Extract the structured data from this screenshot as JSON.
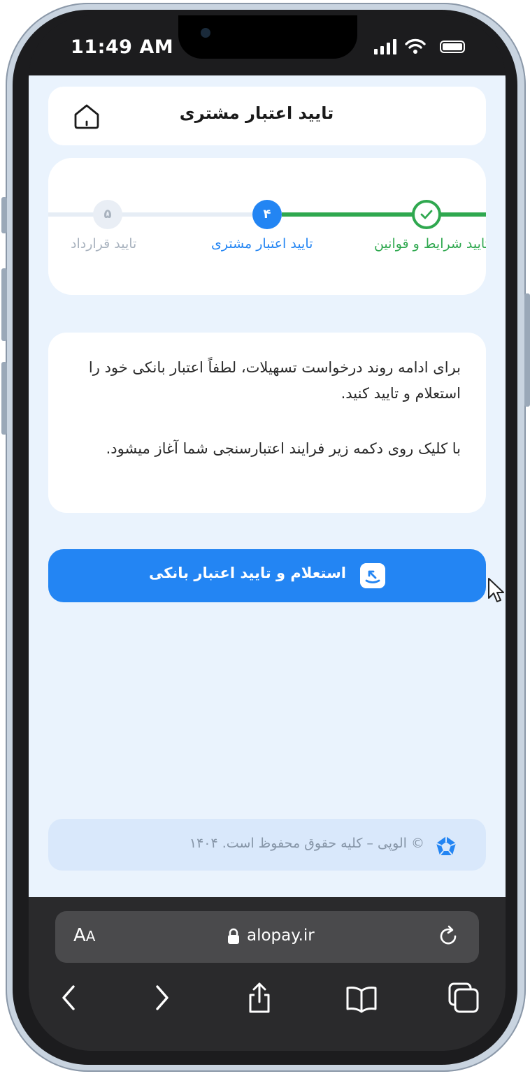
{
  "status_bar": {
    "time": "11:49 AM"
  },
  "header": {
    "title": "تایید اعتبار مشتری"
  },
  "stepper": {
    "steps": [
      {
        "label": "تایید شرایط و قوانین",
        "state": "completed"
      },
      {
        "number": "۴",
        "label": "تایید اعتبار مشتری",
        "state": "active"
      },
      {
        "number": "۵",
        "label": "تایید قرارداد",
        "state": "upcoming"
      }
    ]
  },
  "info": {
    "paragraph1": "برای ادامه روند درخواست تسهیلات، لطفاً اعتبار بانکی خود را استعلام و تایید کنید.",
    "paragraph2": "با کلیک روی دکمه زیر فرایند اعتبارسنجی شما آغاز میشود."
  },
  "primary_button": {
    "label": "استعلام و تایید اعتبار بانکی"
  },
  "footer": {
    "text": "© الوپی – کلیه حقوق محفوظ است. ۱۴۰۴"
  },
  "browser": {
    "text_size_label": "A",
    "text_size_label_small": "A",
    "url": "alopay.ir"
  },
  "colors": {
    "primary": "#2385f3",
    "success": "#2fa84f",
    "muted": "#a8b2be",
    "page_bg": "#eaf3fd"
  }
}
